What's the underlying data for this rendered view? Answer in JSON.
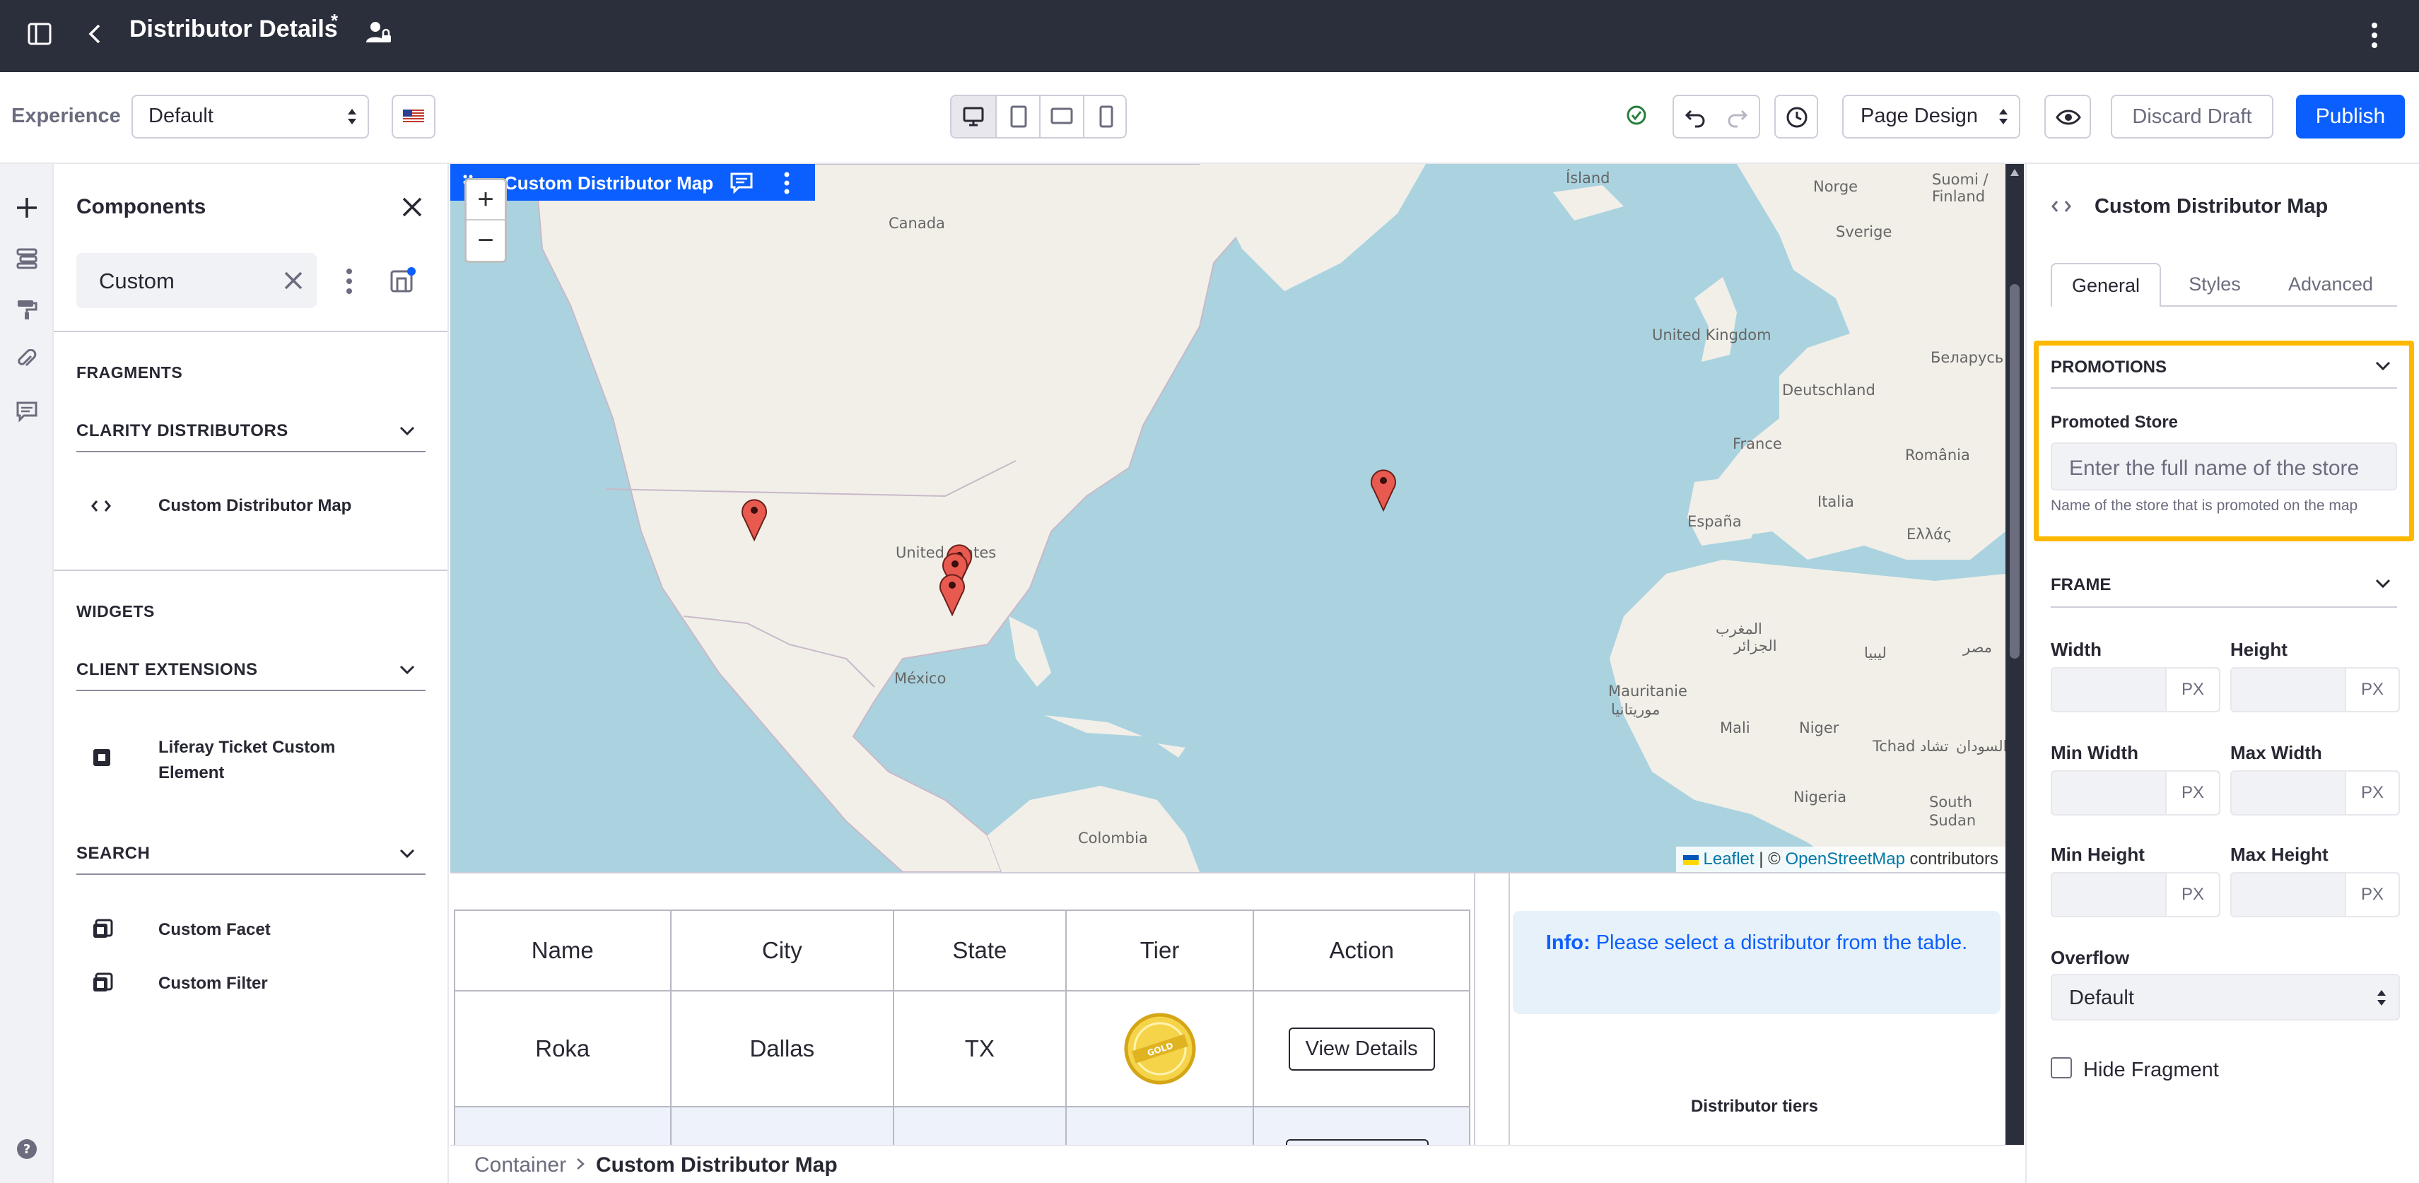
{
  "topbar": {
    "title": "Distributor Details",
    "modified_marker": "*"
  },
  "toolbar": {
    "experience_label": "Experience",
    "experience_value": "Default",
    "page_design_value": "Page Design",
    "discard_label": "Discard Draft",
    "publish_label": "Publish"
  },
  "panel": {
    "title": "Components",
    "search_value": "Custom",
    "fragments_label": "FRAGMENTS",
    "group1": "CLARITY DISTRIBUTORS",
    "group1_item": "Custom Distributor Map",
    "widgets_label": "WIDGETS",
    "group2": "CLIENT EXTENSIONS",
    "group2_item_line1": "Liferay Ticket Custom",
    "group2_item_line2": "Element",
    "group3": "SEARCH",
    "group3_item1": "Custom Facet",
    "group3_item2": "Custom Filter"
  },
  "canvas": {
    "fragment_name": "Custom Distributor Map",
    "zoom_in": "+",
    "zoom_out": "−",
    "map_labels": {
      "canada": "Canada",
      "us": "United States",
      "mexico": "México",
      "colombia": "Colombia",
      "island": "Ísland",
      "norge": "Norge",
      "finland": "Suomi / Finland",
      "sverige": "Sverige",
      "uk": "United Kingdom",
      "belarus": "Беларусь",
      "deutschland": "Deutschland",
      "france": "France",
      "romania": "România",
      "italia": "Italia",
      "espana": "España",
      "ellas": "Ελλάς",
      "maghreb": "المغرب",
      "algeria": "الجزائر",
      "libya": "ليبيا",
      "misr": "مصر",
      "mauritanie": "Mauritanie",
      "mauritanie_ar": "موريتانيا",
      "mali": "Mali",
      "niger": "Niger",
      "tchad": "Tchad تشاد",
      "sudan": "السودان",
      "nigeria": "Nigeria",
      "south_sudan": "South Sudan"
    },
    "attribution_leaflet": "Leaflet",
    "attribution_sep": " | © ",
    "attribution_osm": "OpenStreetMap",
    "attribution_rest": " contributors",
    "table": {
      "headers": [
        "Name",
        "City",
        "State",
        "Tier",
        "Action"
      ],
      "row1": {
        "name": "Roka",
        "city": "Dallas",
        "state": "TX",
        "tier_badge": "GOLD",
        "action": "View Details"
      }
    },
    "info_bold": "Info:",
    "info_text": "Please select a distributor from the table.",
    "tiers_label": "Distributor tiers"
  },
  "breadcrumb": {
    "item1": "Container",
    "item2": "Custom Distributor Map"
  },
  "right": {
    "title": "Custom Distributor Map",
    "tabs": [
      "General",
      "Styles",
      "Advanced"
    ],
    "promotions_label": "PROMOTIONS",
    "promoted_store_label": "Promoted Store",
    "promoted_store_placeholder": "Enter the full name of the store",
    "promoted_store_help": "Name of the store that is promoted on the map",
    "frame_label": "FRAME",
    "width_label": "Width",
    "height_label": "Height",
    "min_width_label": "Min Width",
    "max_width_label": "Max Width",
    "min_height_label": "Min Height",
    "max_height_label": "Max Height",
    "unit": "PX",
    "overflow_label": "Overflow",
    "overflow_value": "Default",
    "hide_fragment_label": "Hide Fragment"
  },
  "colors": {
    "topbar": "#2b2e3b",
    "primary": "#0b5fff",
    "highlight": "#ffb800",
    "water": "#aad3df",
    "land": "#f2efe9",
    "marker": "#e85a4f"
  }
}
